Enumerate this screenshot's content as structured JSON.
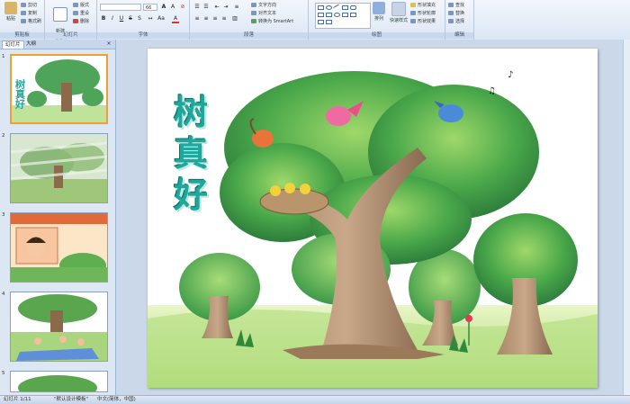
{
  "ribbon": {
    "clipboard": {
      "paste": "粘贴",
      "cut": "剪切",
      "copy": "复制",
      "format_painter": "格式刷",
      "label": "剪贴板"
    },
    "slides": {
      "new_slide": "新建\n幻灯片",
      "layout": "版式",
      "reset": "重设",
      "delete": "删除",
      "label": "幻灯片"
    },
    "font": {
      "font_size": "66",
      "label": "字体"
    },
    "paragraph": {
      "text_direction": "文字方向",
      "align_text": "对齐文本",
      "smartart": "转换为 SmartArt",
      "label": "段落"
    },
    "drawing": {
      "arrange": "排列",
      "quick_styles": "快速样式",
      "shape_fill": "形状填充",
      "shape_outline": "形状轮廓",
      "shape_effects": "形状效果",
      "label": "绘图"
    },
    "editing": {
      "find": "查找",
      "replace": "替换",
      "select": "选择",
      "label": "编辑"
    }
  },
  "pane": {
    "tabs": [
      "幻灯片",
      "大纲"
    ],
    "slide_numbers": [
      "1",
      "2",
      "3",
      "4",
      "5"
    ]
  },
  "slide": {
    "title": "树真好"
  },
  "status": {
    "slide_counter": "幻灯片 1/11",
    "theme": "\"默认设计模板\"",
    "language": "中文(简体，中国)"
  }
}
